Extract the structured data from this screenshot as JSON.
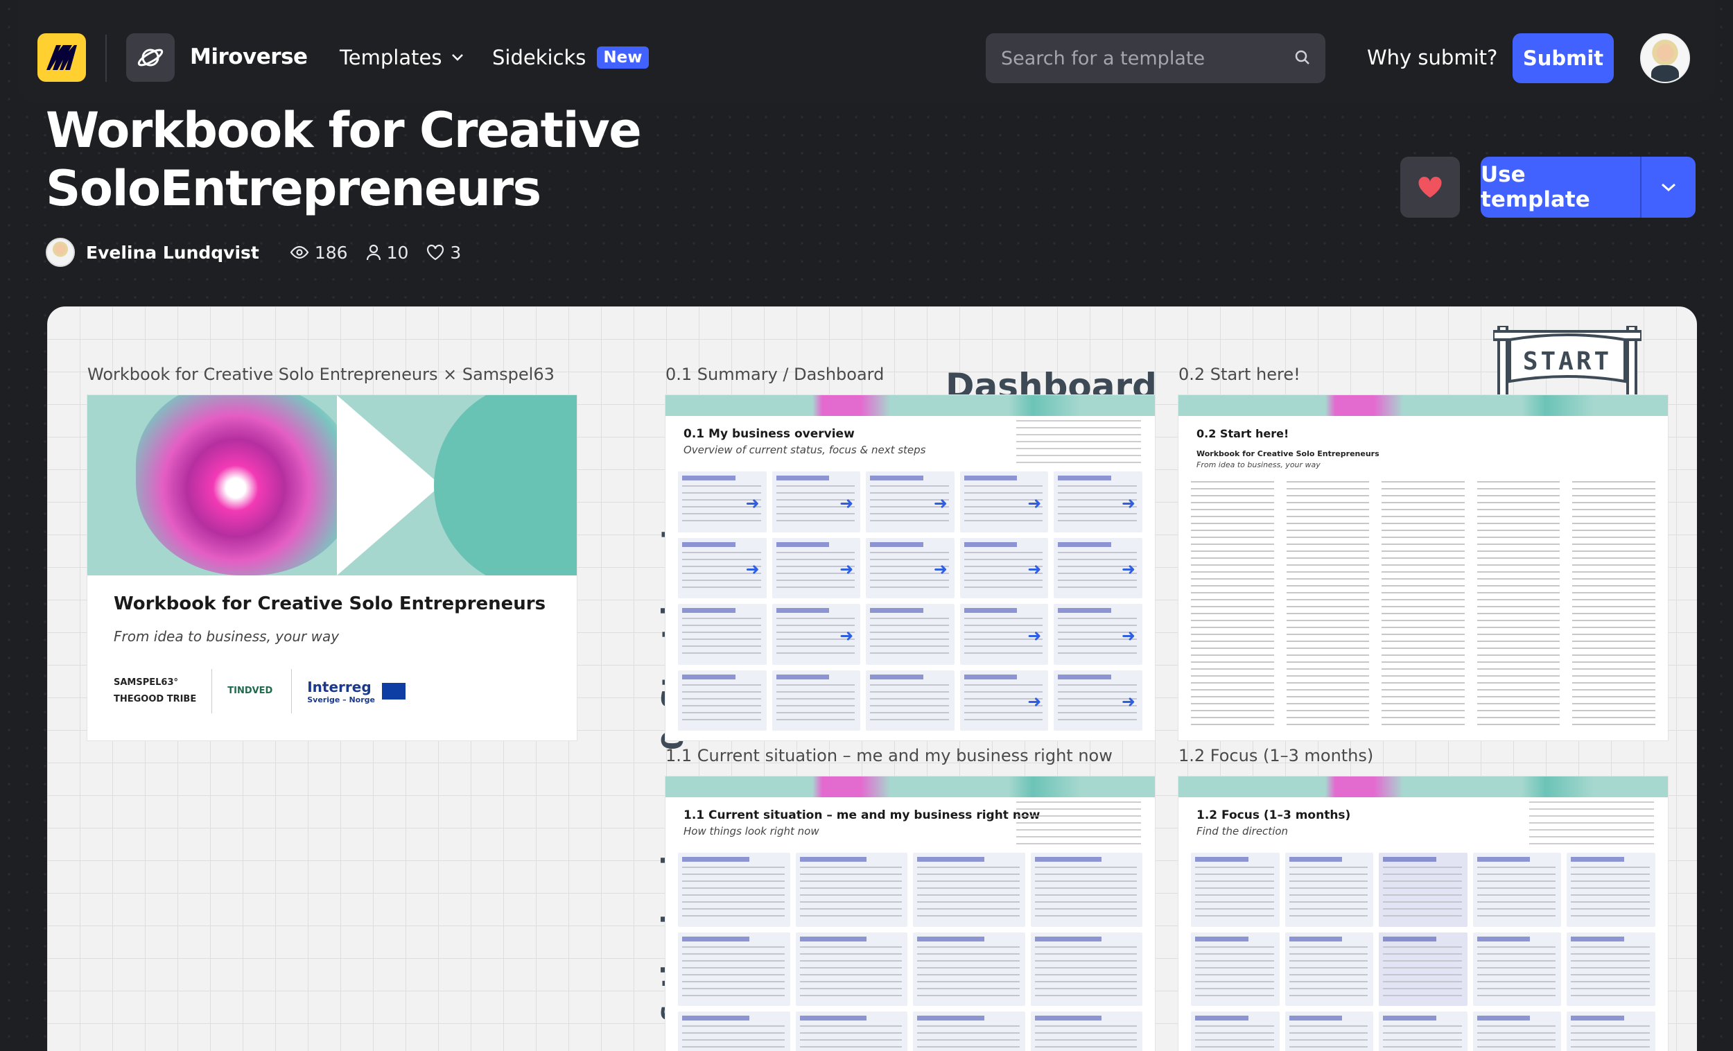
{
  "header": {
    "brand": "Miroverse",
    "nav_templates": "Templates",
    "nav_sidekicks": "Sidekicks",
    "badge_new": "New",
    "search_placeholder": "Search for a template",
    "why_submit": "Why submit?",
    "submit": "Submit"
  },
  "template": {
    "title_line1": "Workbook for Creative",
    "title_line2": "SoloEntrepreneurs",
    "author": "Evelina Lundqvist",
    "views": "186",
    "uses": "10",
    "likes": "3",
    "use_template": "Use template"
  },
  "board": {
    "frames": [
      {
        "title": "Workbook for Creative Solo Entrepreneurs × Samspel63"
      },
      {
        "title": "0.1 Summary / Dashboard"
      },
      {
        "title": "0.2 Start here!"
      },
      {
        "title": "1.1 Current situation – me and my business right now"
      },
      {
        "title": "1.2 Focus (1–3 months)"
      }
    ],
    "dashboard_label": "Dashboard",
    "start_sign": "START",
    "side_label_1": "0. Start here!",
    "side_label_2": "u & the business",
    "cover": {
      "heading": "Workbook for Creative Solo Entrepreneurs",
      "subheading": "From idea to business, your way",
      "logos": [
        "SAMSPEL63°",
        "THEGOOD TRIBE",
        "Interreg",
        "Sverige – Norge",
        "TINDVED"
      ]
    },
    "sheets": {
      "summary_title": "0.1 My business overview",
      "summary_sub": "Overview of current status, focus & next steps",
      "start_title": "0.2 Start here!",
      "start_sub_1": "Workbook for Creative Solo Entrepreneurs",
      "start_sub_2": "From idea to business, your way",
      "current_title": "1.1 Current situation – me and my business right now",
      "current_sub": "How things look right now",
      "focus_title": "1.2 Focus (1–3 months)",
      "focus_sub": "Find the direction"
    }
  },
  "colors": {
    "accent": "#4262ff",
    "logo_yellow": "#ffd02f",
    "heart": "#f0535e"
  }
}
